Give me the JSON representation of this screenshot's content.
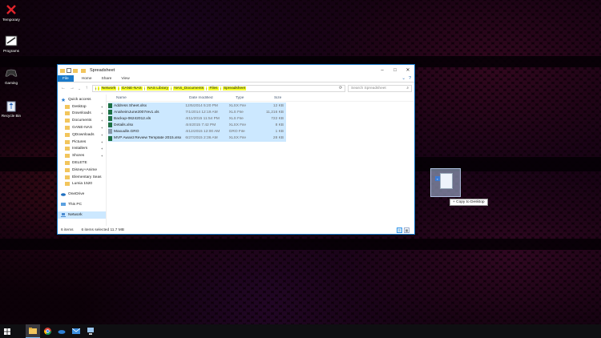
{
  "desktop": {
    "icons": [
      {
        "label": "Temporary",
        "icon": "red-x-icon"
      },
      {
        "label": "Programs",
        "icon": "programs-icon"
      },
      {
        "label": "Gaming",
        "icon": "gamepad-icon"
      },
      {
        "label": "Recycle Bin",
        "icon": "recycle-bin-icon"
      }
    ]
  },
  "window": {
    "title": "Spreadsheet",
    "ribbon_tabs": [
      "File",
      "Home",
      "Share",
      "View"
    ],
    "address": {
      "crumbs": [
        "Network",
        "GANE-NAS",
        "NAS Library",
        "NAS_Documents",
        "Files",
        "Spreadsheet"
      ]
    },
    "search_placeholder": "Search Spreadsheet",
    "nav_pane": {
      "quick_access": "Quick access",
      "items": [
        {
          "label": "Desktop",
          "pinned": true
        },
        {
          "label": "Downloads",
          "pinned": true
        },
        {
          "label": "Documents",
          "pinned": true
        },
        {
          "label": "GANE-NAS",
          "pinned": true
        },
        {
          "label": "QDownloads",
          "pinned": true
        },
        {
          "label": "Pictures",
          "pinned": true
        },
        {
          "label": "Installers",
          "pinned": true
        },
        {
          "label": "Shores",
          "pinned": true
        },
        {
          "label": "DELETE",
          "pinned": false
        },
        {
          "label": "Disney+Anime",
          "pinned": false
        },
        {
          "label": "Elementary Seas",
          "pinned": false
        },
        {
          "label": "Lumia 1520",
          "pinned": false
        }
      ],
      "onedrive": "OneDrive",
      "this_pc": "This PC",
      "network": "Network"
    },
    "columns": {
      "name": "Name",
      "date": "Date modified",
      "type": "Type",
      "size": "Size"
    },
    "files": [
      {
        "name": "Address Sheet.xlsx",
        "date": "12/5/2014 5:20 PM",
        "type": "XLSX File",
        "size": "12 KB"
      },
      {
        "name": "AnaheimJune2007rev1.xls",
        "date": "7/1/2014 12:19 AM",
        "type": "XLS File",
        "size": "11,216 KB"
      },
      {
        "name": "Backup-06242012.xls",
        "date": "4/11/2015 11:54 PM",
        "type": "XLS File",
        "size": "722 KB"
      },
      {
        "name": "Details.xlsx",
        "date": "4/4/2015 7:42 PM",
        "type": "XLSX File",
        "size": "8 KB"
      },
      {
        "name": "Maxuulle.GRO",
        "date": "4/12/2015 12:00 AM",
        "type": "GRO File",
        "size": "1 KB"
      },
      {
        "name": "MVP Award Review Template 2015.xlsx",
        "date": "6/27/2015 2:36 AM",
        "type": "XLSX File",
        "size": "28 KB"
      }
    ],
    "status": {
      "count": "6 items",
      "selected": "6 items selected  11.7 MB"
    }
  },
  "drag": {
    "tooltip": "+ Copy to Desktop"
  },
  "taskbar": {
    "items": [
      "start-icon",
      "search-icon",
      "file-explorer-icon",
      "chrome-icon",
      "onedrive-icon",
      "mail-icon",
      "network-share-icon"
    ]
  },
  "colors": {
    "accent": "#1979ca",
    "selection": "#cce8ff",
    "highlight": "#f5ff2a"
  }
}
